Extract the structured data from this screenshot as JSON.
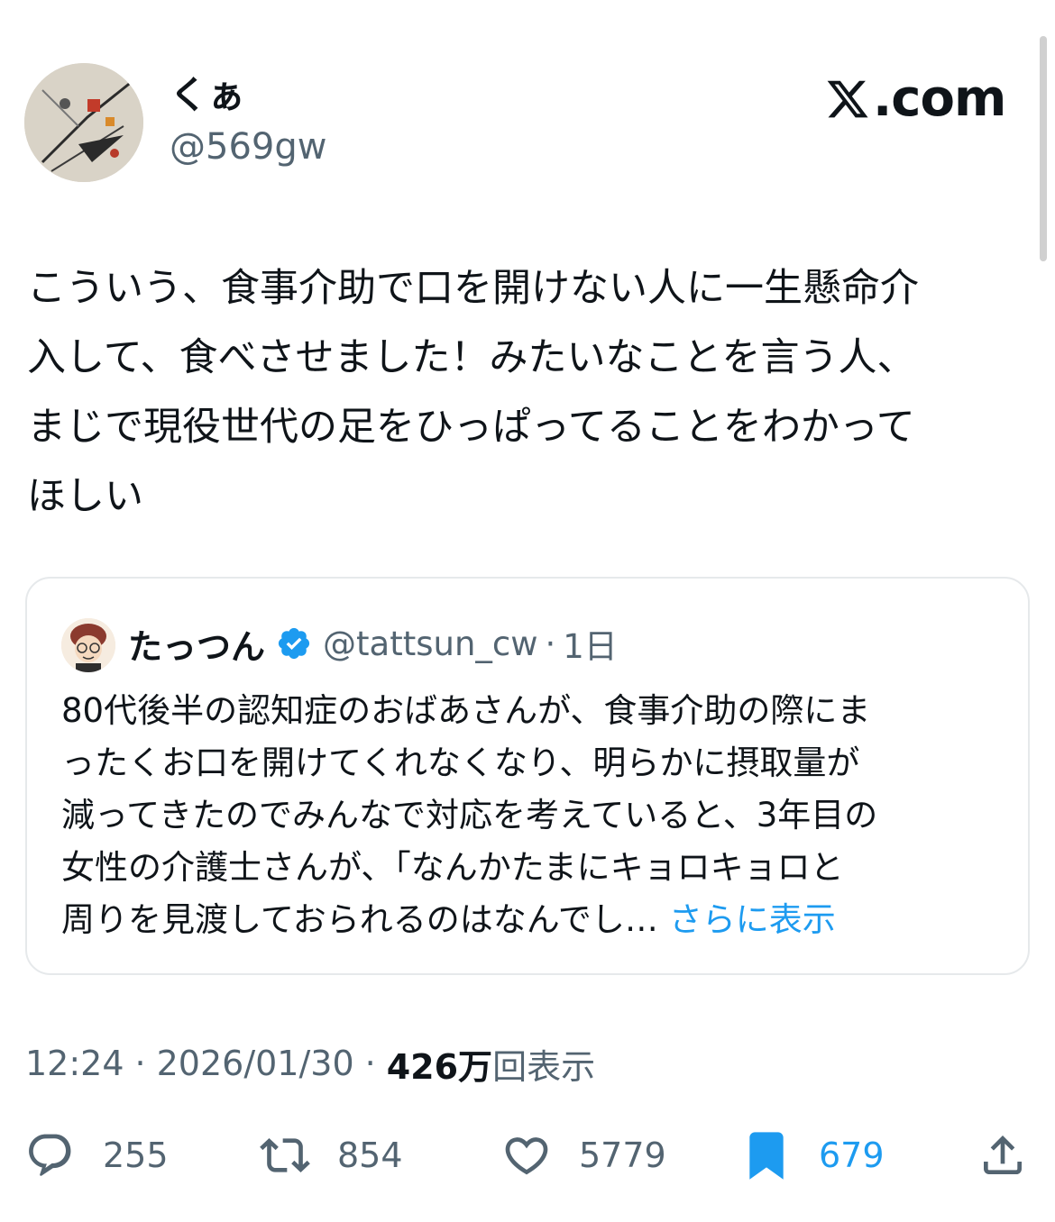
{
  "author": {
    "display_name": "くぁ",
    "handle": "@569gw"
  },
  "brand": {
    "label": ".com",
    "icon": "x-logo-icon"
  },
  "tweet": {
    "text": "こういう、食事介助で口を開けない人に一生懸命介\n入して、食べさせました！みたいなことを言う人、\nまじで現役世代の足をひっぱってることをわかって\nほしい"
  },
  "quote": {
    "display_name": "たっつん",
    "verified_icon": "verified-badge-icon",
    "handle": "@tattsun_cw",
    "separator": "·",
    "time": "1日",
    "text": "80代後半の認知症のおばあさんが、食事介助の際にま\nったくお口を開けてくれなくなり、明らかに摂取量が\n減ってきたのでみんなで対応を考えていると、3年目の\n女性の介護士さんが、「なんかたまにキョロキョロと\n周りを見渡しておられるのはなんでし… ",
    "show_more": "さらに表示"
  },
  "meta": {
    "time": "12:24",
    "sep1": "·",
    "date": "2026/01/30",
    "sep2": "·",
    "views_count": "426万",
    "views_label": "回表示"
  },
  "actions": {
    "replies": {
      "icon": "reply-icon",
      "count": "255"
    },
    "retweets": {
      "icon": "retweet-icon",
      "count": "854"
    },
    "likes": {
      "icon": "heart-icon",
      "count": "5779"
    },
    "bookmarks": {
      "icon": "bookmark-icon",
      "count": "679",
      "active": true
    },
    "share": {
      "icon": "share-icon"
    }
  },
  "colors": {
    "text": "#0f1419",
    "secondary": "#536471",
    "accent": "#1d9bf0",
    "border": "#e6e9eb"
  }
}
